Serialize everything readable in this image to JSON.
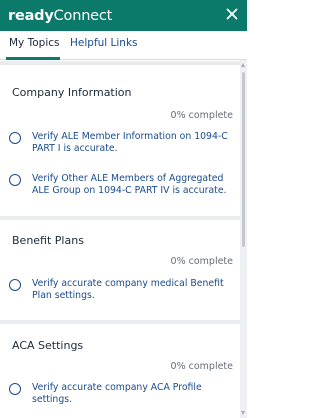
{
  "header": {
    "brand_bold": "ready",
    "brand_rest": "Connect",
    "close_glyph": "✕",
    "bg_color": "#0b7a6b"
  },
  "tabs": [
    {
      "label": "My Topics",
      "active": true
    },
    {
      "label": "Helpful Links",
      "active": false
    }
  ],
  "sections": [
    {
      "title": "Company Information",
      "progress": "0% complete",
      "tasks": [
        {
          "label": "Verify ALE Member Information on 1094-C PART I is accurate."
        },
        {
          "label": "Verify Other ALE Members of Aggregated ALE Group on 1094-C PART IV is accurate."
        }
      ]
    },
    {
      "title": "Benefit Plans",
      "progress": "0% complete",
      "tasks": [
        {
          "label": "Verify accurate company medical Benefit Plan settings."
        }
      ]
    },
    {
      "title": "ACA Settings",
      "progress": "0% complete",
      "tasks": [
        {
          "label": "Verify accurate company ACA Profile settings."
        }
      ]
    }
  ],
  "icons": {
    "close": "close-icon",
    "radio": "radio-unchecked-icon"
  }
}
